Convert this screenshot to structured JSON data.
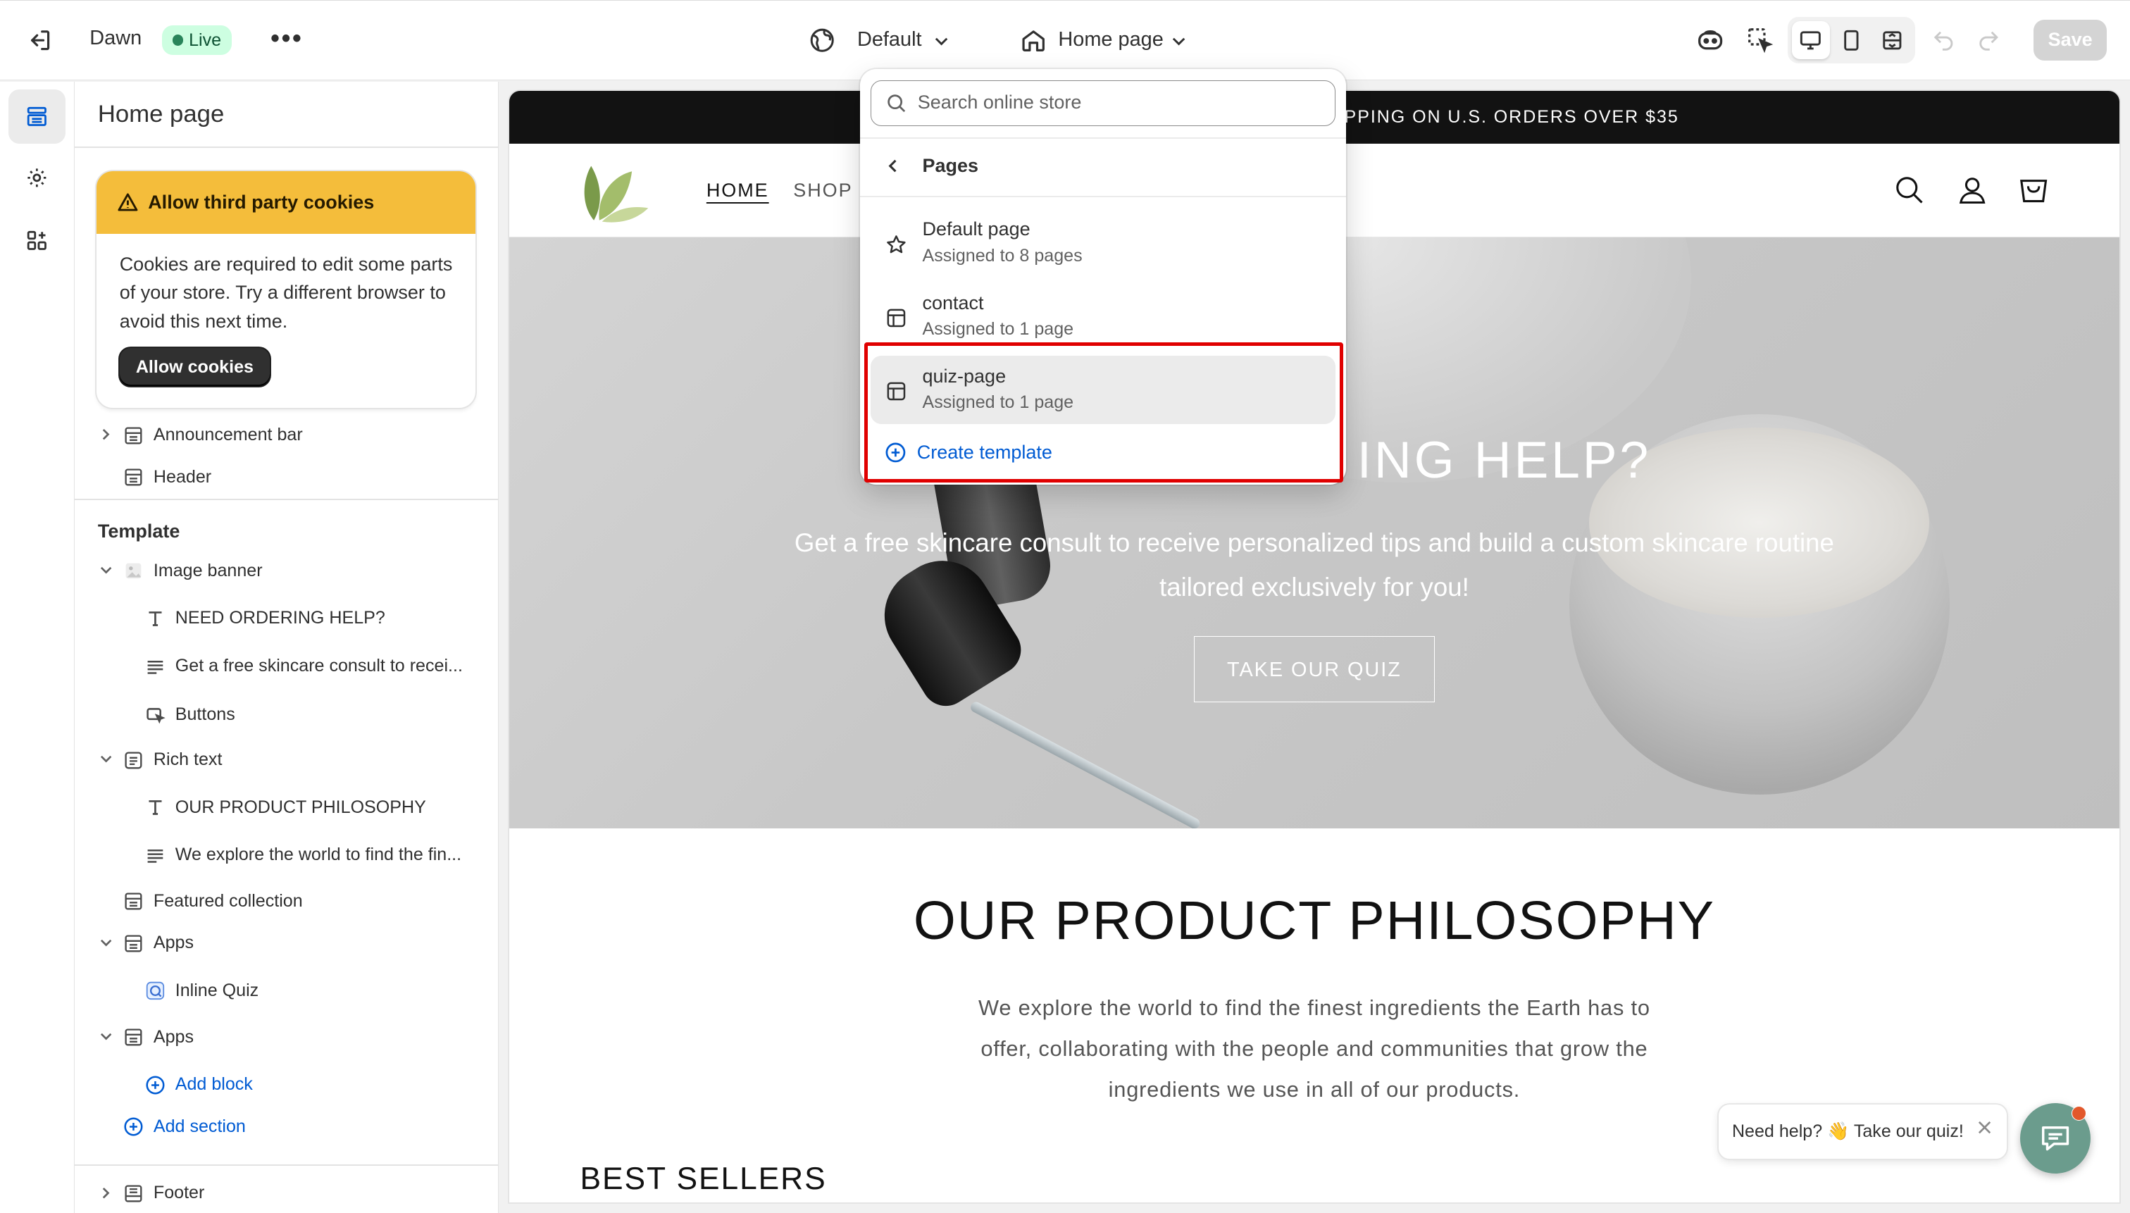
{
  "topbar": {
    "store_name": "Dawn",
    "status_badge": "Live",
    "more": "•••",
    "theme_select": "Default",
    "page_select": "Home page",
    "save_label": "Save"
  },
  "sidebar": {
    "title": "Home page",
    "cookie_notice": {
      "title": "Allow third party cookies",
      "body": "Cookies are required to edit some parts of your store. Try a different browser to avoid this next time.",
      "button": "Allow cookies"
    },
    "header_items": [
      "Announcement bar",
      "Header"
    ],
    "template_heading": "Template",
    "template_items": [
      "Image banner",
      "NEED ORDERING HELP?",
      "Get a free skincare consult to recei...",
      "Buttons",
      "Rich text",
      "OUR PRODUCT PHILOSOPHY",
      "We explore the world to find the fin...",
      "Featured collection",
      "Apps",
      "Inline Quiz",
      "Apps"
    ],
    "add_block": "Add block",
    "add_section": "Add section",
    "footer_item": "Footer"
  },
  "dropdown": {
    "search_placeholder": "Search online store",
    "section_title": "Pages",
    "items": [
      {
        "title": "Default page",
        "subtitle": "Assigned to 8 pages",
        "icon": "star-icon"
      },
      {
        "title": "contact",
        "subtitle": "Assigned to 1 page",
        "icon": "layout-icon"
      },
      {
        "title": "quiz-page",
        "subtitle": "Assigned to 1 page",
        "icon": "layout-icon",
        "highlighted": true
      }
    ],
    "create_template": "Create template"
  },
  "preview": {
    "announcement": "IPPING ON U.S. ORDERS OVER $35",
    "nav": [
      "HOME",
      "SHOP"
    ],
    "hero": {
      "title": "ING HELP?",
      "subtitle": "Get a free skincare consult to receive personalized tips and build a custom skincare routine tailored exclusively for you!",
      "button": "TAKE OUR QUIZ"
    },
    "philosophy": {
      "title": "OUR PRODUCT PHILOSOPHY",
      "body": "We explore the world to find the finest ingredients the Earth has to offer, collaborating with the people and communities that grow the ingredients we use in all of our products."
    },
    "best_sellers": "BEST SELLERS",
    "chat_prompt": "Need help? 👋 Take our quiz!"
  },
  "colors": {
    "live_badge_bg": "#cdfee1",
    "warning_bg": "#f4bd3b",
    "link_blue": "#005bd3",
    "annotation_red": "#e00000",
    "chat_fab": "#6b9c8d"
  }
}
